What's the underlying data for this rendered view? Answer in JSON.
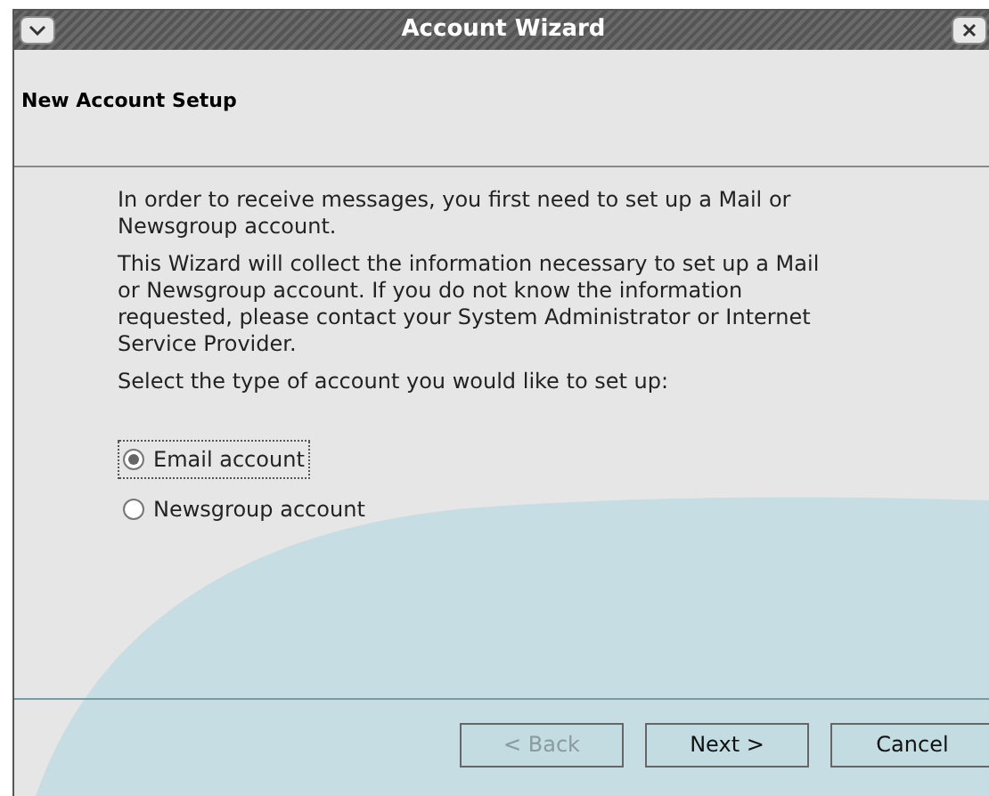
{
  "window": {
    "title": "Account Wizard"
  },
  "page": {
    "title": "New Account Setup"
  },
  "paragraphs": [
    "In order to receive messages, you first need to set up a Mail or Newsgroup account.",
    "This Wizard will collect the information necessary to set up a Mail or Newsgroup account. If you do not know the information requested, please contact your System Administrator or Internet Service Provider.",
    "Select the type of account you would like to set up:"
  ],
  "options": [
    {
      "label": "Email account",
      "selected": true
    },
    {
      "label": "Newsgroup account",
      "selected": false
    }
  ],
  "buttons": [
    {
      "label": "< Back",
      "disabled": true
    },
    {
      "label": "Next >",
      "disabled": false
    },
    {
      "label": "Cancel",
      "disabled": false
    }
  ]
}
